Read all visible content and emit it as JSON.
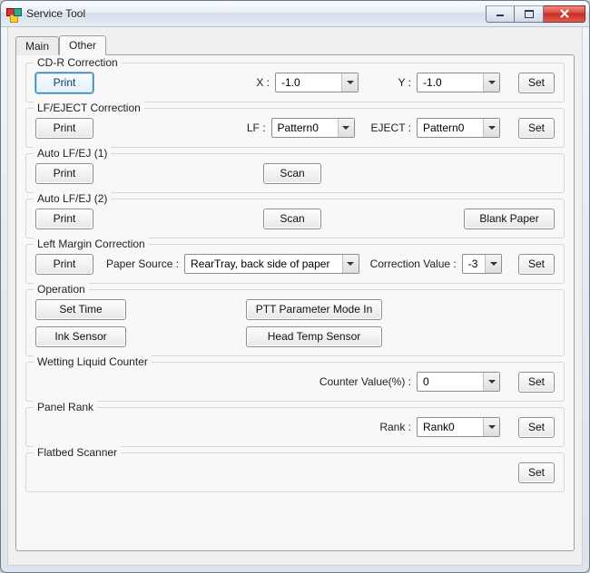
{
  "window": {
    "title": "Service Tool"
  },
  "tabs": {
    "main": "Main",
    "other": "Other",
    "active": "other"
  },
  "groups": {
    "cdr": {
      "title": "CD-R Correction",
      "print": "Print",
      "x_label": "X :",
      "x_value": "-1.0",
      "y_label": "Y :",
      "y_value": "-1.0",
      "set": "Set"
    },
    "lfej": {
      "title": "LF/EJECT Correction",
      "print": "Print",
      "lf_label": "LF :",
      "lf_value": "Pattern0",
      "eject_label": "EJECT :",
      "eject_value": "Pattern0",
      "set": "Set"
    },
    "auto1": {
      "title": "Auto LF/EJ (1)",
      "print": "Print",
      "scan": "Scan"
    },
    "auto2": {
      "title": "Auto LF/EJ (2)",
      "print": "Print",
      "scan": "Scan",
      "blank": "Blank Paper"
    },
    "lm": {
      "title": "Left Margin Correction",
      "print": "Print",
      "source_label": "Paper Source :",
      "source_value": "RearTray, back side of paper",
      "corr_label": "Correction Value :",
      "corr_value": "-3",
      "set": "Set"
    },
    "op": {
      "title": "Operation",
      "set_time": "Set Time",
      "ptt": "PTT Parameter Mode In",
      "ink": "Ink Sensor",
      "head": "Head Temp Sensor"
    },
    "wet": {
      "title": "Wetting Liquid Counter",
      "label": "Counter Value(%) :",
      "value": "0",
      "set": "Set"
    },
    "rank": {
      "title": "Panel Rank",
      "label": "Rank :",
      "value": "Rank0",
      "set": "Set"
    },
    "flat": {
      "title": "Flatbed Scanner",
      "set": "Set"
    }
  }
}
